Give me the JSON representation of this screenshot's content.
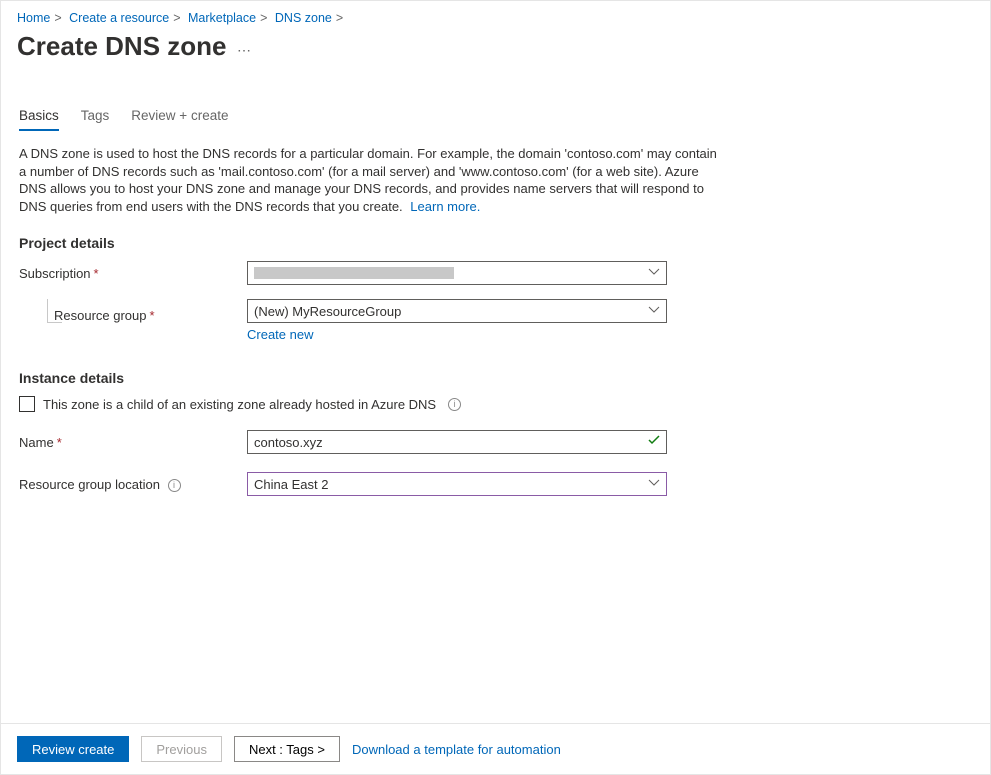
{
  "breadcrumbs": [
    "Home",
    "Create a resource",
    "Marketplace",
    "DNS zone"
  ],
  "title": "Create DNS zone",
  "tabs": {
    "basics": "Basics",
    "tags": "Tags",
    "review": "Review + create"
  },
  "description": "A DNS zone is used to host the DNS records for a particular domain. For example, the domain 'contoso.com' may contain a number of DNS records such as 'mail.contoso.com' (for a mail server) and 'www.contoso.com' (for a web site). Azure DNS allows you to host your DNS zone and manage your DNS records, and provides name servers that will respond to DNS queries from end users with the DNS records that you create.",
  "learn_more": "Learn more.",
  "sections": {
    "project": "Project details",
    "instance": "Instance details"
  },
  "labels": {
    "subscription": "Subscription",
    "resource_group": "Resource group",
    "create_new": "Create new",
    "child_zone": "This zone is a child of an existing zone already hosted in Azure DNS",
    "name": "Name",
    "rg_location": "Resource group location"
  },
  "values": {
    "subscription": "",
    "resource_group": "(New) MyResourceGroup",
    "name": "contoso.xyz",
    "rg_location": "China East 2"
  },
  "footer": {
    "review": "Review create",
    "previous": "Previous",
    "next": "Next : Tags >",
    "download": "Download a template for automation"
  }
}
